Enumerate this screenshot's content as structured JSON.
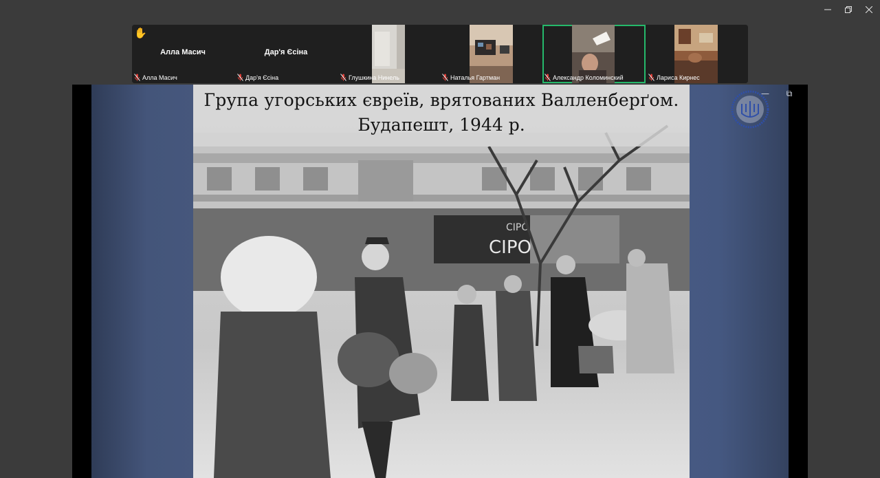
{
  "window": {
    "controls": {
      "minimize_icon": "minimize-icon",
      "maximize_icon": "restore-icon",
      "close_icon": "close-icon"
    }
  },
  "participants": [
    {
      "name": "Алла Масич",
      "display_name": "Алла Масич",
      "video": false,
      "muted": true,
      "raised_hand": true
    },
    {
      "name": "Дар'я Єсіна",
      "display_name": "Дар'я Єсіна",
      "video": false,
      "muted": true
    },
    {
      "name": "Глушкина Нинель",
      "video": true,
      "muted": true
    },
    {
      "name": "Наталья Гартман",
      "video": true,
      "muted": true
    },
    {
      "name": "Александр Коломинский",
      "video": true,
      "muted": true,
      "active_speaker": true
    },
    {
      "name": "Лариса Кирнес",
      "video": true,
      "muted": true
    }
  ],
  "slide": {
    "caption_line_1": "Група угорських євреїв, врятованих Валленберґом.",
    "caption_line_2": "Будапешт, 1944  р.",
    "sign_text": "CIPO",
    "sign_text_small": "CIPŐ"
  },
  "colors": {
    "active_speaker_border": "#25b96b",
    "mute_icon": "#e0403a",
    "raise_hand": "#f2b418",
    "background": "#3b3b3b"
  }
}
